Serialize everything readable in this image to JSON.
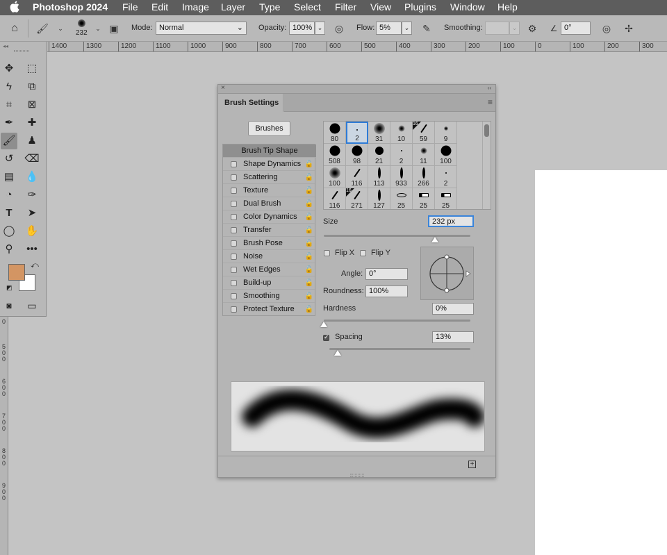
{
  "menubar": {
    "apple": "",
    "app_name": "Photoshop 2024",
    "items": [
      "File",
      "Edit",
      "Image",
      "Layer",
      "Type",
      "Select",
      "Filter",
      "View",
      "Plugins",
      "Window",
      "Help"
    ]
  },
  "options_bar": {
    "brush_size": "232",
    "mode_label": "Mode:",
    "mode_value": "Normal",
    "opacity_label": "Opacity:",
    "opacity_value": "100%",
    "flow_label": "Flow:",
    "flow_value": "5%",
    "smoothing_label": "Smoothing:",
    "smoothing_value": "",
    "angle_value": "0°"
  },
  "ruler_top": [
    "1400",
    "1300",
    "1200",
    "1100",
    "1000",
    "900",
    "800",
    "700",
    "600",
    "500",
    "400",
    "300",
    "200",
    "100",
    "0",
    "100",
    "200",
    "300"
  ],
  "ruler_left": [
    "0",
    "5 0 0",
    "6 0 0",
    "7 0 0",
    "8 0 0",
    "9 0 0"
  ],
  "colors": {
    "foreground": "#d39563",
    "background": "#ffffff",
    "selection_blue": "#2e7bd6"
  },
  "panel": {
    "title": "Brush Settings",
    "brushes_button": "Brushes",
    "options": [
      {
        "label": "Brush Tip Shape",
        "active": true
      },
      {
        "label": "Shape Dynamics"
      },
      {
        "label": "Scattering"
      },
      {
        "label": "Texture"
      },
      {
        "label": "Dual Brush"
      },
      {
        "label": "Color Dynamics"
      },
      {
        "label": "Transfer"
      },
      {
        "label": "Brush Pose"
      },
      {
        "label": "Noise"
      },
      {
        "label": "Wet Edges"
      },
      {
        "label": "Build-up"
      },
      {
        "label": "Smoothing"
      },
      {
        "label": "Protect Texture"
      }
    ],
    "brush_grid": [
      {
        "size": "80",
        "tip": "hard"
      },
      {
        "size": "2",
        "tip": "dot",
        "selected": true
      },
      {
        "size": "31",
        "tip": "soft"
      },
      {
        "size": "10",
        "tip": "soft"
      },
      {
        "size": "59",
        "tip": "stroke",
        "badge": "16"
      },
      {
        "size": "9",
        "tip": "soft"
      },
      {
        "size": "508",
        "tip": "hard"
      },
      {
        "size": "98",
        "tip": "hard"
      },
      {
        "size": "21",
        "tip": "hard"
      },
      {
        "size": "2",
        "tip": "dot"
      },
      {
        "size": "11",
        "tip": "soft"
      },
      {
        "size": "100",
        "tip": "hard"
      },
      {
        "size": "100",
        "tip": "soft"
      },
      {
        "size": "116",
        "tip": "stroke"
      },
      {
        "size": "113",
        "tip": "leaf"
      },
      {
        "size": "933",
        "tip": "leaf"
      },
      {
        "size": "266",
        "tip": "leaf"
      },
      {
        "size": "2",
        "tip": "dot"
      },
      {
        "size": "116",
        "tip": "stroke"
      },
      {
        "size": "271",
        "tip": "stroke",
        "badge": "16"
      },
      {
        "size": "127",
        "tip": "leaf"
      },
      {
        "size": "25",
        "tip": "eye"
      },
      {
        "size": "25",
        "tip": "rect"
      },
      {
        "size": "25",
        "tip": "rect"
      }
    ],
    "size_label": "Size",
    "size_value": "232 px",
    "size_fraction": 0.76,
    "flip_x_label": "Flip X",
    "flip_y_label": "Flip Y",
    "angle_label": "Angle:",
    "angle_value": "0°",
    "roundness_label": "Roundness:",
    "roundness_value": "100%",
    "hardness_label": "Hardness",
    "hardness_value": "0%",
    "hardness_fraction": 0,
    "spacing_label": "Spacing",
    "spacing_value": "13%",
    "spacing_fraction": 0.06
  }
}
